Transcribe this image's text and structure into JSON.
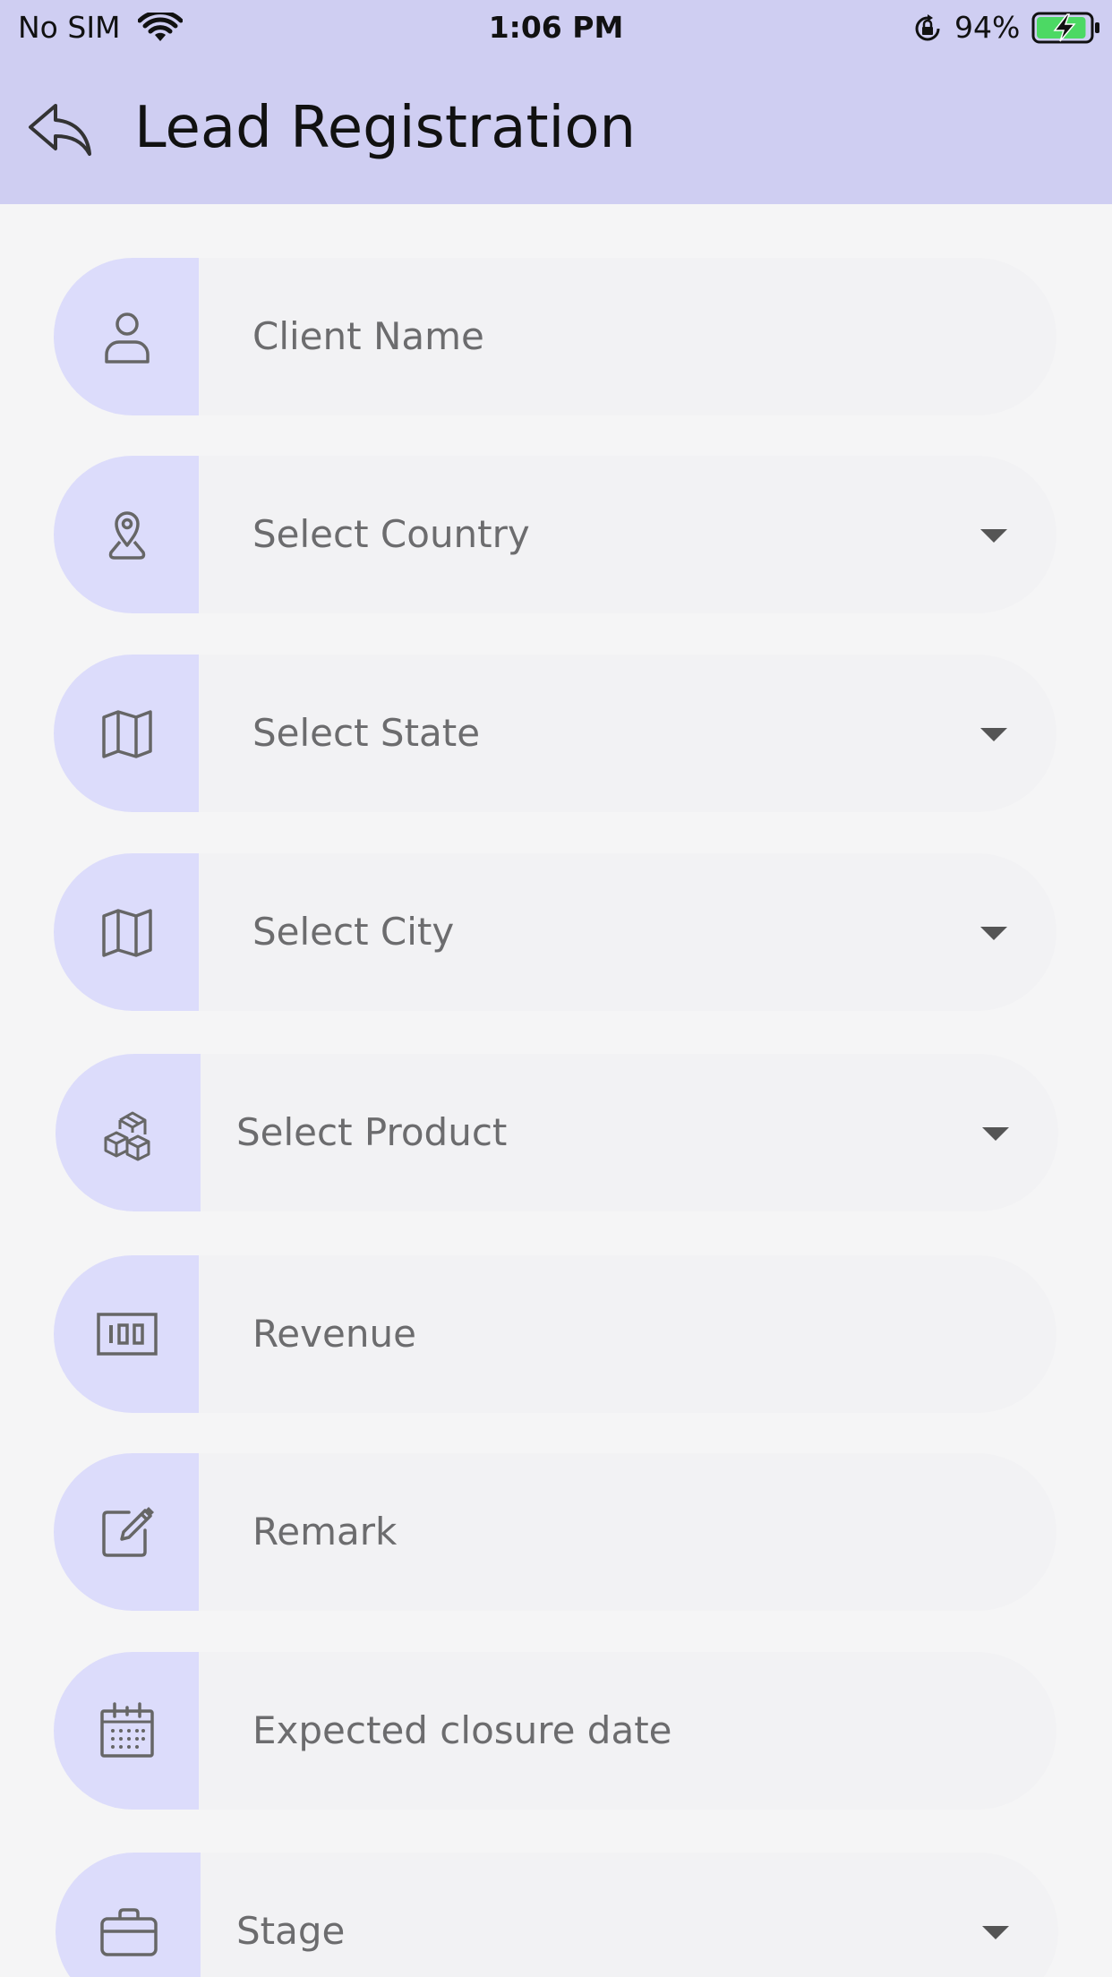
{
  "status_bar": {
    "carrier": "No SIM",
    "time": "1:06 PM",
    "battery_percent": "94%",
    "battery_level": 0.94,
    "battery_color": "#4cd964",
    "icons": [
      "wifi-icon",
      "orientation-lock-icon",
      "battery-charging-icon"
    ]
  },
  "header": {
    "title": "Lead Registration",
    "back_icon": "reply-arrow-icon",
    "background": "#cfcef2"
  },
  "form": {
    "accent_color": "#dcdcfb",
    "fields": [
      {
        "label": "Client Name",
        "icon": "person-icon",
        "type": "text"
      },
      {
        "label": "Select Country",
        "icon": "location-pin-icon",
        "type": "dropdown"
      },
      {
        "label": "Select State",
        "icon": "map-icon",
        "type": "dropdown"
      },
      {
        "label": "Select City",
        "icon": "map-icon",
        "type": "dropdown"
      },
      {
        "label": "Select Product",
        "icon": "boxes-icon",
        "type": "dropdown"
      },
      {
        "label": "Revenue",
        "icon": "money-icon",
        "type": "text"
      },
      {
        "label": "Remark",
        "icon": "edit-icon",
        "type": "text"
      },
      {
        "label": "Expected closure date",
        "icon": "calendar-icon",
        "type": "date"
      },
      {
        "label": "Stage",
        "icon": "briefcase-icon",
        "type": "dropdown"
      }
    ]
  }
}
